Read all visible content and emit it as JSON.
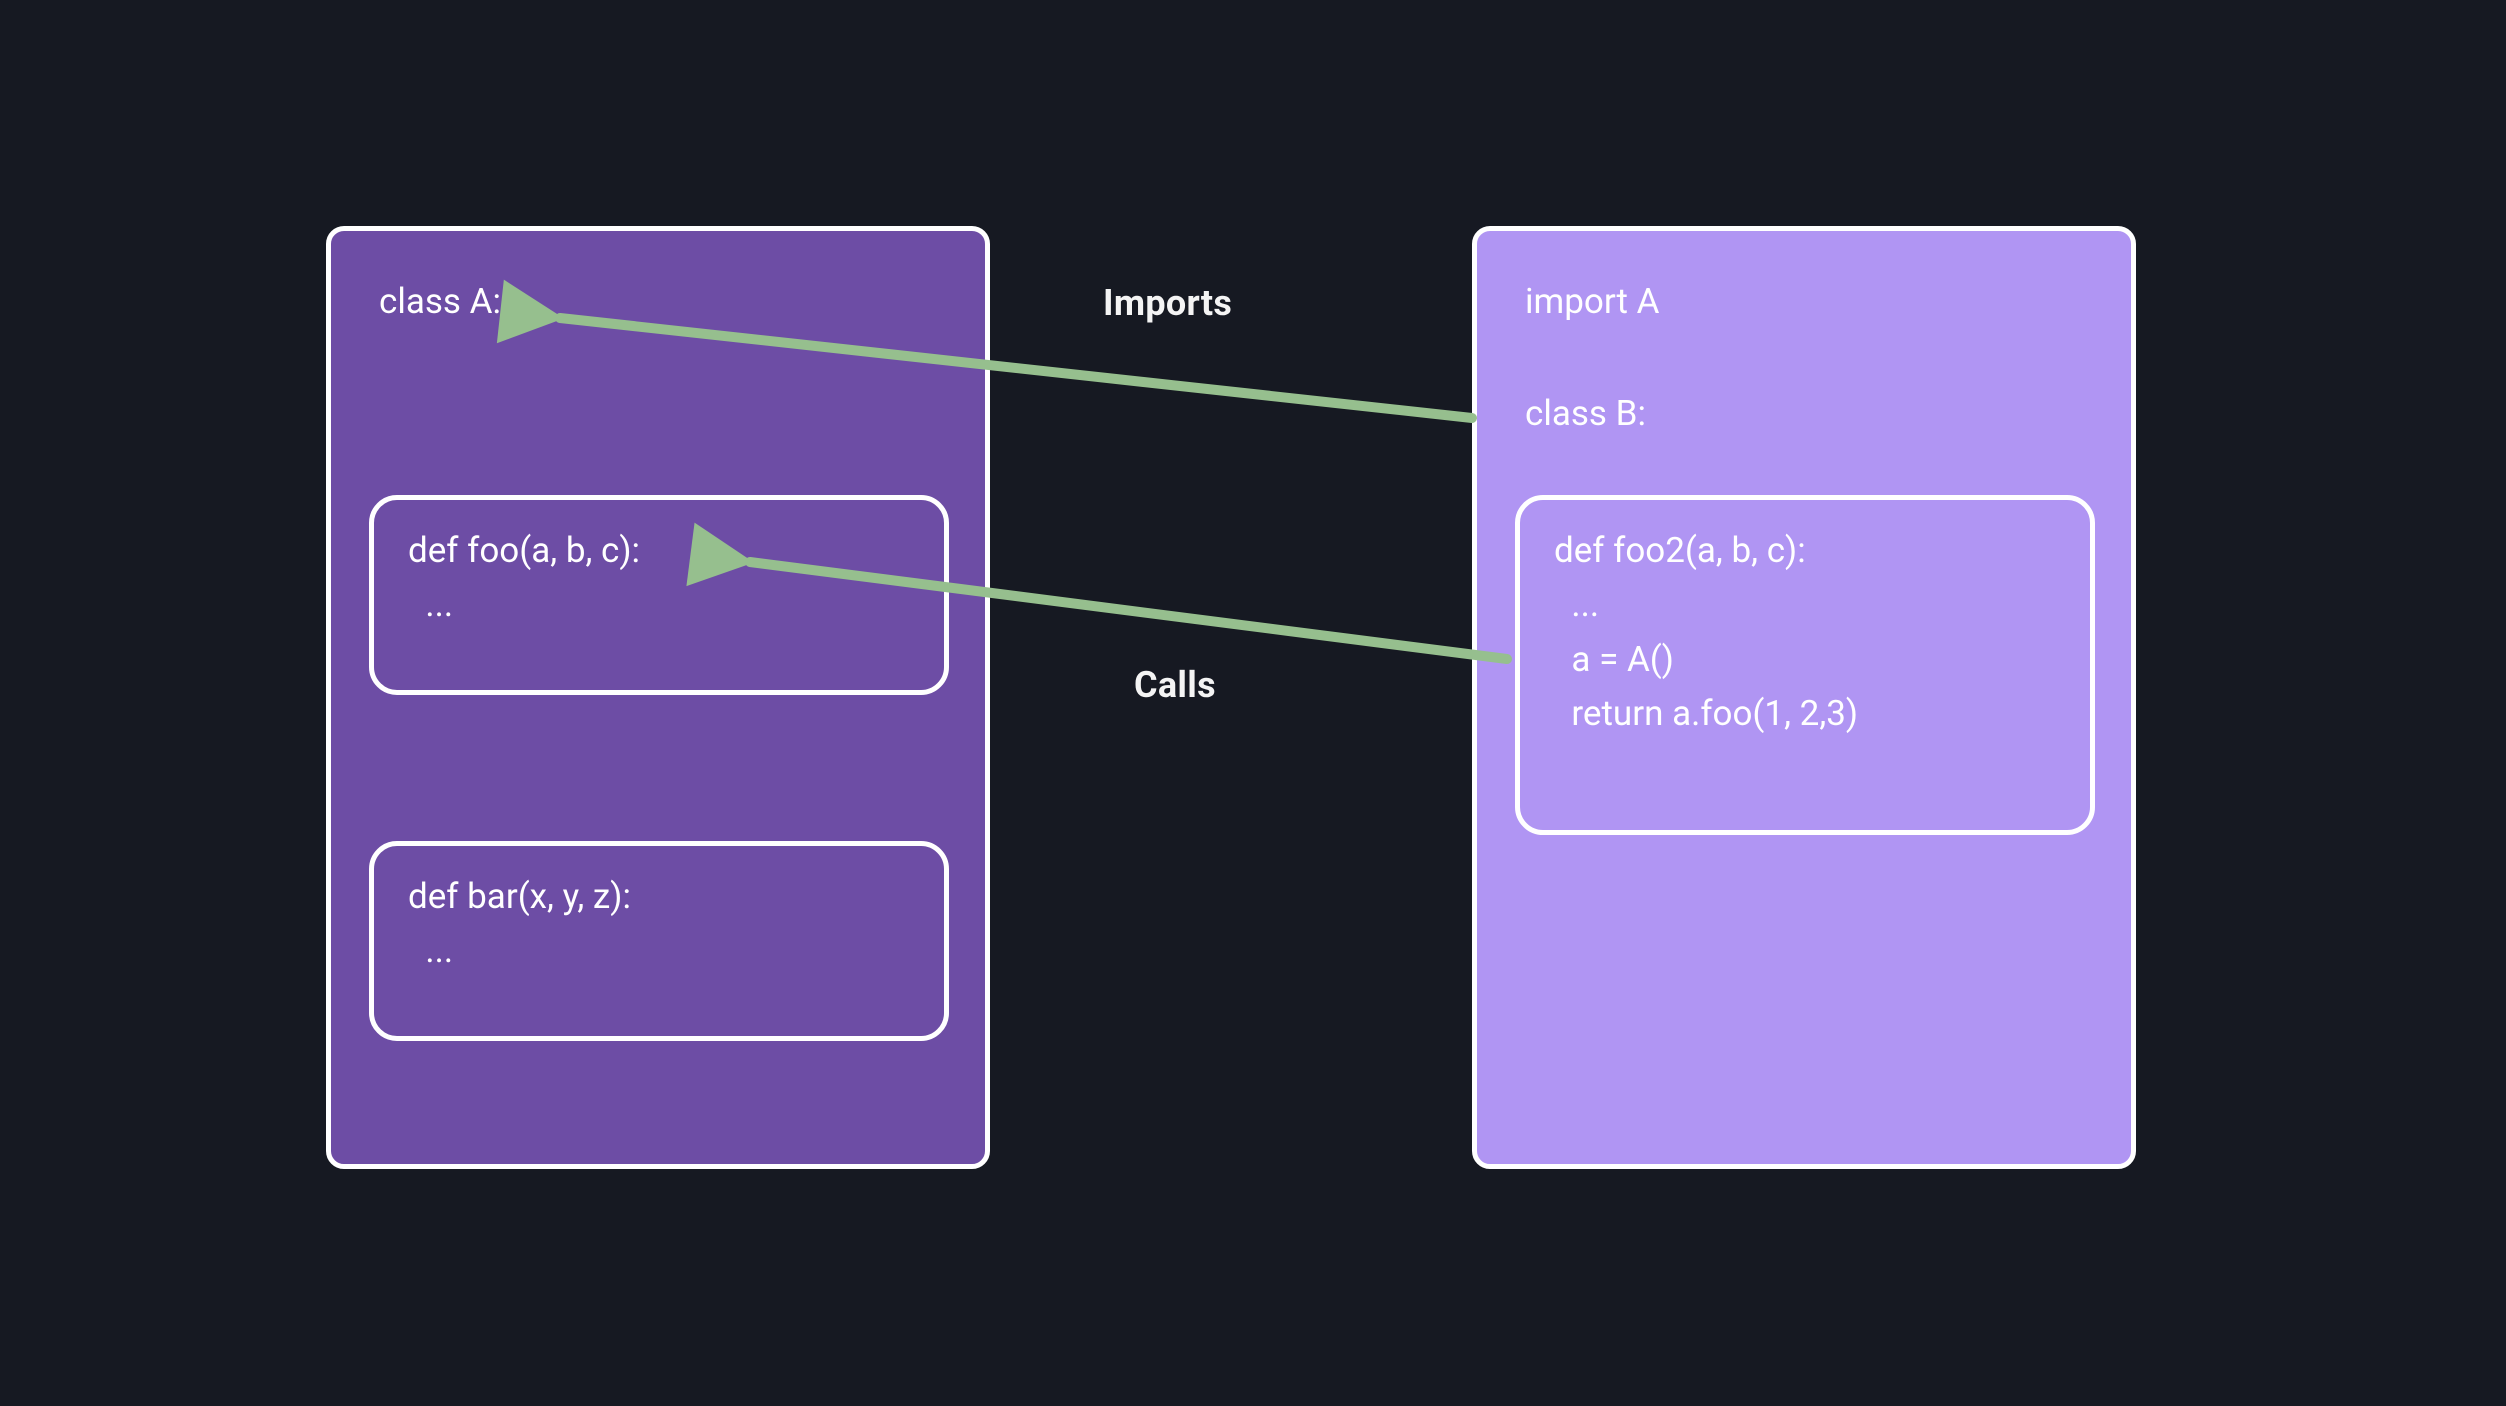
{
  "labels": {
    "imports": "Imports",
    "calls": "Calls"
  },
  "classA": {
    "header": "class A:",
    "foo": {
      "sig": "def foo(a, b, c):",
      "body": "  ..."
    },
    "bar": {
      "sig": "def bar(x, y, z):",
      "body": "  ..."
    }
  },
  "classB": {
    "import_line": "import A",
    "header": "class B:",
    "foo2": {
      "sig": "def foo2(a, b, c):",
      "l1": "  ...",
      "l2": "  a = A()",
      "l3": "  return a.foo(1, 2,3)"
    }
  },
  "colors": {
    "arrow": "#96BF8E",
    "left_box": "#6D4DA5",
    "right_box": "#B095F3",
    "bg": "#161922"
  }
}
